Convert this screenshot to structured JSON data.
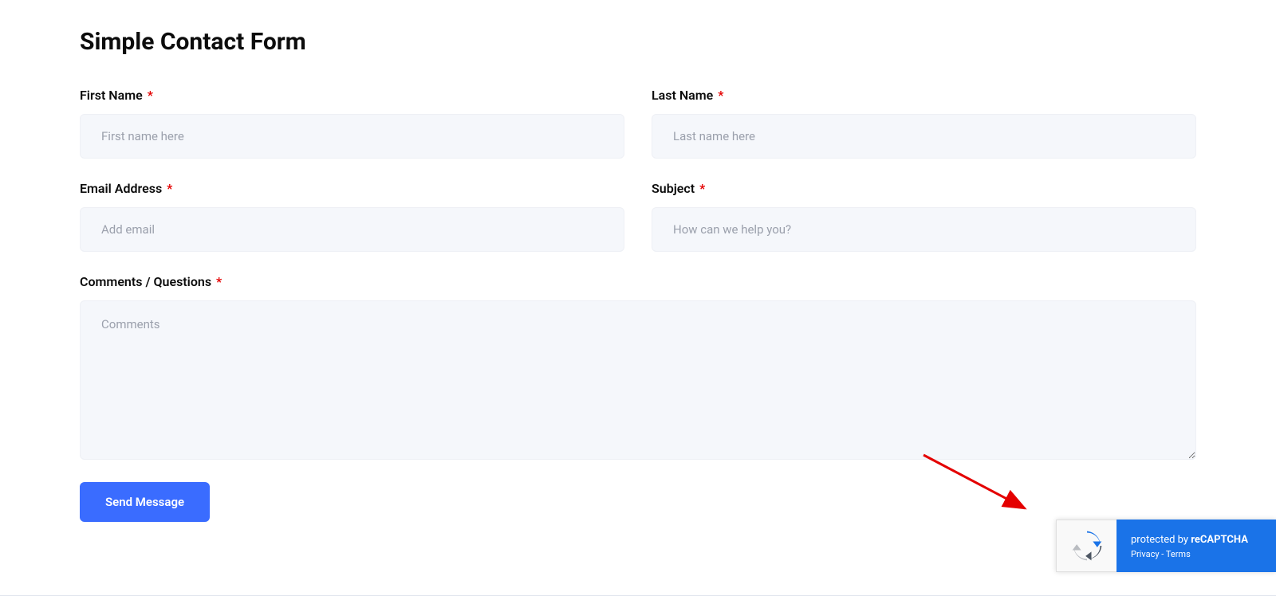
{
  "form": {
    "title": "Simple Contact Form",
    "fields": {
      "first_name": {
        "label": "First Name",
        "placeholder": "First name here",
        "required": true
      },
      "last_name": {
        "label": "Last Name",
        "placeholder": "Last name here",
        "required": true
      },
      "email": {
        "label": "Email Address",
        "placeholder": "Add email",
        "required": true
      },
      "subject": {
        "label": "Subject",
        "placeholder": "How can we help you?",
        "required": true
      },
      "comments": {
        "label": "Comments / Questions",
        "placeholder": "Comments",
        "required": true
      }
    },
    "submit_label": "Send Message"
  },
  "recaptcha": {
    "protected_text": "protected by ",
    "brand_text": "reCAPTCHA",
    "privacy_label": "Privacy",
    "separator": " - ",
    "terms_label": "Terms"
  },
  "required_marker": "*"
}
